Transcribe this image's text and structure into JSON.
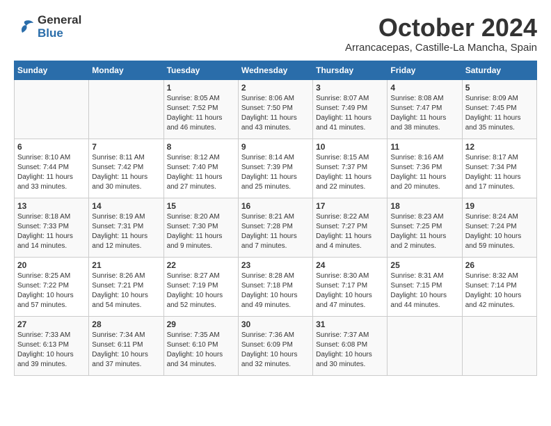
{
  "logo": {
    "line1": "General",
    "line2": "Blue"
  },
  "title": "October 2024",
  "subtitle": "Arrancacepas, Castille-La Mancha, Spain",
  "days_header": [
    "Sunday",
    "Monday",
    "Tuesday",
    "Wednesday",
    "Thursday",
    "Friday",
    "Saturday"
  ],
  "weeks": [
    [
      {
        "day": "",
        "info": ""
      },
      {
        "day": "",
        "info": ""
      },
      {
        "day": "1",
        "info": "Sunrise: 8:05 AM\nSunset: 7:52 PM\nDaylight: 11 hours and 46 minutes."
      },
      {
        "day": "2",
        "info": "Sunrise: 8:06 AM\nSunset: 7:50 PM\nDaylight: 11 hours and 43 minutes."
      },
      {
        "day": "3",
        "info": "Sunrise: 8:07 AM\nSunset: 7:49 PM\nDaylight: 11 hours and 41 minutes."
      },
      {
        "day": "4",
        "info": "Sunrise: 8:08 AM\nSunset: 7:47 PM\nDaylight: 11 hours and 38 minutes."
      },
      {
        "day": "5",
        "info": "Sunrise: 8:09 AM\nSunset: 7:45 PM\nDaylight: 11 hours and 35 minutes."
      }
    ],
    [
      {
        "day": "6",
        "info": "Sunrise: 8:10 AM\nSunset: 7:44 PM\nDaylight: 11 hours and 33 minutes."
      },
      {
        "day": "7",
        "info": "Sunrise: 8:11 AM\nSunset: 7:42 PM\nDaylight: 11 hours and 30 minutes."
      },
      {
        "day": "8",
        "info": "Sunrise: 8:12 AM\nSunset: 7:40 PM\nDaylight: 11 hours and 27 minutes."
      },
      {
        "day": "9",
        "info": "Sunrise: 8:14 AM\nSunset: 7:39 PM\nDaylight: 11 hours and 25 minutes."
      },
      {
        "day": "10",
        "info": "Sunrise: 8:15 AM\nSunset: 7:37 PM\nDaylight: 11 hours and 22 minutes."
      },
      {
        "day": "11",
        "info": "Sunrise: 8:16 AM\nSunset: 7:36 PM\nDaylight: 11 hours and 20 minutes."
      },
      {
        "day": "12",
        "info": "Sunrise: 8:17 AM\nSunset: 7:34 PM\nDaylight: 11 hours and 17 minutes."
      }
    ],
    [
      {
        "day": "13",
        "info": "Sunrise: 8:18 AM\nSunset: 7:33 PM\nDaylight: 11 hours and 14 minutes."
      },
      {
        "day": "14",
        "info": "Sunrise: 8:19 AM\nSunset: 7:31 PM\nDaylight: 11 hours and 12 minutes."
      },
      {
        "day": "15",
        "info": "Sunrise: 8:20 AM\nSunset: 7:30 PM\nDaylight: 11 hours and 9 minutes."
      },
      {
        "day": "16",
        "info": "Sunrise: 8:21 AM\nSunset: 7:28 PM\nDaylight: 11 hours and 7 minutes."
      },
      {
        "day": "17",
        "info": "Sunrise: 8:22 AM\nSunset: 7:27 PM\nDaylight: 11 hours and 4 minutes."
      },
      {
        "day": "18",
        "info": "Sunrise: 8:23 AM\nSunset: 7:25 PM\nDaylight: 11 hours and 2 minutes."
      },
      {
        "day": "19",
        "info": "Sunrise: 8:24 AM\nSunset: 7:24 PM\nDaylight: 10 hours and 59 minutes."
      }
    ],
    [
      {
        "day": "20",
        "info": "Sunrise: 8:25 AM\nSunset: 7:22 PM\nDaylight: 10 hours and 57 minutes."
      },
      {
        "day": "21",
        "info": "Sunrise: 8:26 AM\nSunset: 7:21 PM\nDaylight: 10 hours and 54 minutes."
      },
      {
        "day": "22",
        "info": "Sunrise: 8:27 AM\nSunset: 7:19 PM\nDaylight: 10 hours and 52 minutes."
      },
      {
        "day": "23",
        "info": "Sunrise: 8:28 AM\nSunset: 7:18 PM\nDaylight: 10 hours and 49 minutes."
      },
      {
        "day": "24",
        "info": "Sunrise: 8:30 AM\nSunset: 7:17 PM\nDaylight: 10 hours and 47 minutes."
      },
      {
        "day": "25",
        "info": "Sunrise: 8:31 AM\nSunset: 7:15 PM\nDaylight: 10 hours and 44 minutes."
      },
      {
        "day": "26",
        "info": "Sunrise: 8:32 AM\nSunset: 7:14 PM\nDaylight: 10 hours and 42 minutes."
      }
    ],
    [
      {
        "day": "27",
        "info": "Sunrise: 7:33 AM\nSunset: 6:13 PM\nDaylight: 10 hours and 39 minutes."
      },
      {
        "day": "28",
        "info": "Sunrise: 7:34 AM\nSunset: 6:11 PM\nDaylight: 10 hours and 37 minutes."
      },
      {
        "day": "29",
        "info": "Sunrise: 7:35 AM\nSunset: 6:10 PM\nDaylight: 10 hours and 34 minutes."
      },
      {
        "day": "30",
        "info": "Sunrise: 7:36 AM\nSunset: 6:09 PM\nDaylight: 10 hours and 32 minutes."
      },
      {
        "day": "31",
        "info": "Sunrise: 7:37 AM\nSunset: 6:08 PM\nDaylight: 10 hours and 30 minutes."
      },
      {
        "day": "",
        "info": ""
      },
      {
        "day": "",
        "info": ""
      }
    ]
  ]
}
